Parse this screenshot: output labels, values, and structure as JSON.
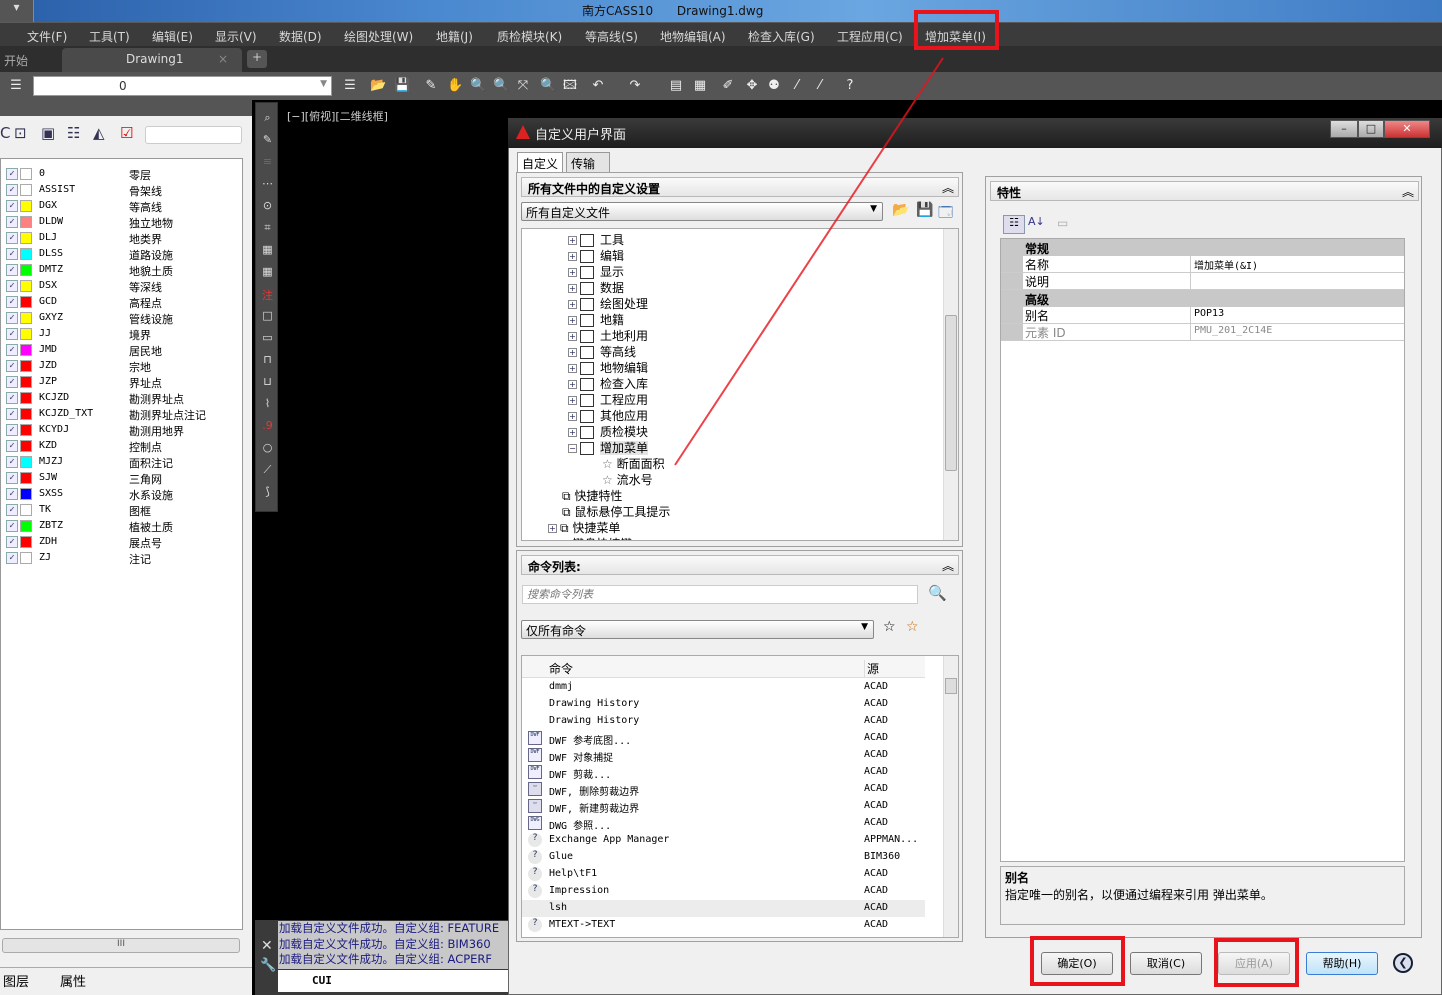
{
  "app": {
    "title": "南方CASS10",
    "file": "Drawing1.dwg"
  },
  "menu": [
    "文件(F)",
    "工具(T)",
    "编辑(E)",
    "显示(V)",
    "数据(D)",
    "绘图处理(W)",
    "地籍(J)",
    "质检模块(K)",
    "等高线(S)",
    "地物编辑(A)",
    "检查入库(G)",
    "工程应用(C)",
    "增加菜单(I)"
  ],
  "tabs": {
    "start": "开始",
    "drawing": "Drawing1",
    "close": "×",
    "new": "+"
  },
  "toolbar": {
    "layer_value": "0"
  },
  "layers": [
    {
      "name": "0",
      "desc": "零层",
      "color": "#ffffff"
    },
    {
      "name": "ASSIST",
      "desc": "骨架线",
      "color": "#ffffff"
    },
    {
      "name": "DGX",
      "desc": "等高线",
      "color": "#ffff00"
    },
    {
      "name": "DLDW",
      "desc": "独立地物",
      "color": "#ff8080"
    },
    {
      "name": "DLJ",
      "desc": "地类界",
      "color": "#ffff00"
    },
    {
      "name": "DLSS",
      "desc": "道路设施",
      "color": "#00ffff"
    },
    {
      "name": "DMTZ",
      "desc": "地貌土质",
      "color": "#00ff00"
    },
    {
      "name": "DSX",
      "desc": "等深线",
      "color": "#ffff00"
    },
    {
      "name": "GCD",
      "desc": "高程点",
      "color": "#ff0000"
    },
    {
      "name": "GXYZ",
      "desc": "管线设施",
      "color": "#ffff00"
    },
    {
      "name": "JJ",
      "desc": "境界",
      "color": "#ffff00"
    },
    {
      "name": "JMD",
      "desc": "居民地",
      "color": "#ff00ff"
    },
    {
      "name": "JZD",
      "desc": "宗地",
      "color": "#ff0000"
    },
    {
      "name": "JZP",
      "desc": "界址点",
      "color": "#ff0000"
    },
    {
      "name": "KCJZD",
      "desc": "勘测界址点",
      "color": "#ff0000"
    },
    {
      "name": "KCJZD_TXT",
      "desc": "勘测界址点注记",
      "color": "#ff0000"
    },
    {
      "name": "KCYDJ",
      "desc": "勘测用地界",
      "color": "#ff0000"
    },
    {
      "name": "KZD",
      "desc": "控制点",
      "color": "#ff0000"
    },
    {
      "name": "MJZJ",
      "desc": "面积注记",
      "color": "#00ffff"
    },
    {
      "name": "SJW",
      "desc": "三角网",
      "color": "#ff0000"
    },
    {
      "name": "SXSS",
      "desc": "水系设施",
      "color": "#0000ff"
    },
    {
      "name": "TK",
      "desc": "图框",
      "color": "#ffffff"
    },
    {
      "name": "ZBTZ",
      "desc": "植被土质",
      "color": "#00ff00"
    },
    {
      "name": "ZDH",
      "desc": "展点号",
      "color": "#ff0000"
    },
    {
      "name": "ZJ",
      "desc": "注记",
      "color": "#ffffff"
    }
  ],
  "left_tabs": {
    "layers": "图层",
    "props": "属性"
  },
  "viewport_label": "[−][俯视][二维线框]",
  "command": {
    "history": [
      "加载自定义文件成功。自定义组: FEATURE",
      "加载自定义文件成功。自定义组: BIM360",
      "加载自定义文件成功。自定义组: ACPERF"
    ],
    "input": "CUI"
  },
  "dialog": {
    "title": "自定义用户界面",
    "tabs": [
      "自定义",
      "传输"
    ],
    "customizations": {
      "header": "所有文件中的自定义设置",
      "file_select": "所有自定义文件",
      "tree": [
        {
          "label": "工具",
          "type": "menu"
        },
        {
          "label": "编辑",
          "type": "menu"
        },
        {
          "label": "显示",
          "type": "menu"
        },
        {
          "label": "数据",
          "type": "menu"
        },
        {
          "label": "绘图处理",
          "type": "menu"
        },
        {
          "label": "地籍",
          "type": "menu"
        },
        {
          "label": "土地利用",
          "type": "menu"
        },
        {
          "label": "等高线",
          "type": "menu"
        },
        {
          "label": "地物编辑",
          "type": "menu"
        },
        {
          "label": "检查入库",
          "type": "menu"
        },
        {
          "label": "工程应用",
          "type": "menu"
        },
        {
          "label": "其他应用",
          "type": "menu"
        },
        {
          "label": "质检模块",
          "type": "menu"
        },
        {
          "label": "增加菜单",
          "type": "menu",
          "expanded": true,
          "selected": true
        },
        {
          "label": "断面面积",
          "type": "item"
        },
        {
          "label": "流水号",
          "type": "item"
        },
        {
          "label": "快捷特性",
          "type": "root"
        },
        {
          "label": "鼠标悬停工具提示",
          "type": "root"
        },
        {
          "label": "快捷菜单",
          "type": "rootexp"
        },
        {
          "label": "键盘快捷键",
          "type": "rootexp"
        }
      ]
    },
    "command_list": {
      "header": "命令列表:",
      "search_placeholder": "搜索命令列表",
      "filter": "仅所有命令",
      "col_command": "命令",
      "col_source": "源",
      "rows": [
        {
          "name": "dmmj",
          "source": "ACAD",
          "icon": ""
        },
        {
          "name": "Drawing History",
          "source": "ACAD",
          "icon": ""
        },
        {
          "name": "Drawing History",
          "source": "ACAD",
          "icon": ""
        },
        {
          "name": "DWF 参考底图...",
          "source": "ACAD",
          "icon": "dwf"
        },
        {
          "name": "DWF 对象捕捉",
          "source": "ACAD",
          "icon": "dwf"
        },
        {
          "name": "DWF 剪裁...",
          "source": "ACAD",
          "icon": "dwf"
        },
        {
          "name": "DWF, 删除剪裁边界",
          "source": "ACAD",
          "icon": "clip"
        },
        {
          "name": "DWF, 新建剪裁边界",
          "source": "ACAD",
          "icon": "clip"
        },
        {
          "name": "DWG 参照...",
          "source": "ACAD",
          "icon": "dwg"
        },
        {
          "name": "Exchange App Manager",
          "source": "APPMAN...",
          "icon": "help"
        },
        {
          "name": "Glue",
          "source": "BIM360",
          "icon": "help"
        },
        {
          "name": "Help\\tF1",
          "source": "ACAD",
          "icon": "help"
        },
        {
          "name": "Impression",
          "source": "ACAD",
          "icon": "help"
        },
        {
          "name": "lsh",
          "source": "ACAD",
          "icon": "",
          "selected": true
        },
        {
          "name": "MTEXT->TEXT",
          "source": "ACAD",
          "icon": "help"
        }
      ]
    },
    "properties": {
      "header": "特性",
      "general": {
        "label": "常规",
        "name_key": "名称",
        "name_value": "增加菜单(&I)",
        "desc_key": "说明",
        "desc_value": ""
      },
      "advanced": {
        "label": "高级",
        "alias_key": "别名",
        "alias_value": "POP13",
        "id_key": "元素 ID",
        "id_value": "PMU_201_2C14E"
      },
      "help_title": "别名",
      "help_text": "指定唯一的别名，以便通过编程来引用 弹出菜单。"
    },
    "buttons": {
      "ok": "确定(O)",
      "cancel": "取消(C)",
      "apply": "应用(A)",
      "help": "帮助(H)"
    }
  },
  "colors": {
    "annotation": "#e8141c",
    "accent_blue": "#3a7bd5"
  }
}
